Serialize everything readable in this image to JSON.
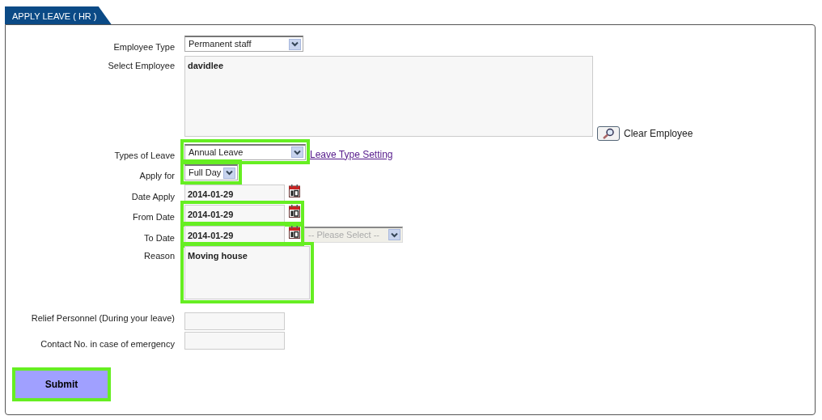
{
  "tab": {
    "label": "APPLY LEAVE ( HR )",
    "selected": true
  },
  "fields": [
    {
      "kind": "select",
      "label": "Employee Type",
      "value": "Permanent staff",
      "highlighted": false
    },
    {
      "kind": "textarea",
      "label": "Select Employee",
      "value": "davidlee",
      "highlighted": false,
      "action": "Clear Employee"
    },
    {
      "kind": "select",
      "label": "Types of Leave",
      "value": "Annual Leave",
      "highlighted": true,
      "link": "Leave Type Setting"
    },
    {
      "kind": "select",
      "label": "Apply for",
      "value": "Full Day",
      "highlighted": true
    },
    {
      "kind": "date",
      "label": "Date Apply",
      "value": "2014-01-29",
      "highlighted": false
    },
    {
      "kind": "date",
      "label": "From Date",
      "value": "2014-01-29",
      "highlighted": true
    },
    {
      "kind": "date",
      "label": "To Date",
      "value": "2014-01-29",
      "highlighted": true,
      "extra_select": {
        "value": "-- Please Select --",
        "disabled": true
      }
    },
    {
      "kind": "textarea",
      "label": "Reason",
      "value": "Moving house",
      "highlighted": true
    },
    {
      "kind": "input",
      "label": "Relief Personnel (During your leave)",
      "highlighted": false
    },
    {
      "kind": "input",
      "label": "Contact No. in case of emergency",
      "highlighted": false
    }
  ],
  "submit": {
    "label": "Submit",
    "highlighted": true
  }
}
